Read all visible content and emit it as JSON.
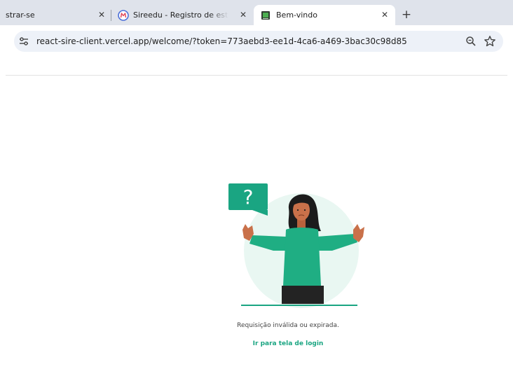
{
  "browser": {
    "tabs": [
      {
        "label": "strar-se",
        "close": "✕"
      },
      {
        "label": "Sireedu - Registro de estudantes",
        "close": "✕"
      },
      {
        "label": "Bem-vindo",
        "close": "✕"
      }
    ],
    "new_tab": "+",
    "url": "react-sire-client.vercel.app/welcome/?token=773aebd3-ee1d-4ca6-a469-3bac30c98d85"
  },
  "page": {
    "message": "Requisição inválida ou expirada.",
    "link_text": "Ir para tela de login",
    "accent_color": "#1aa582",
    "illustration_icon": "confused-person-question-icon",
    "question_mark": "?"
  }
}
